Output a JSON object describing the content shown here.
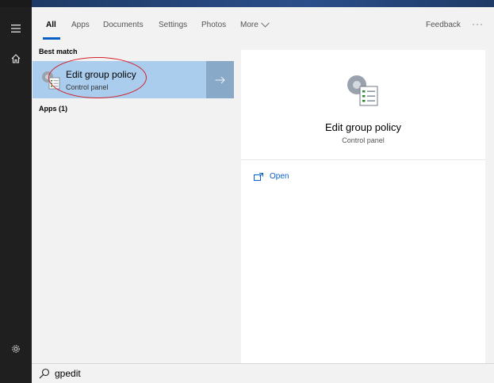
{
  "tabs": [
    {
      "label": "All",
      "active": true
    },
    {
      "label": "Apps"
    },
    {
      "label": "Documents"
    },
    {
      "label": "Settings"
    },
    {
      "label": "Photos"
    },
    {
      "label": "More"
    }
  ],
  "feedback_label": "Feedback",
  "more_options_label": "···",
  "sections": {
    "best_match": "Best match",
    "apps": "Apps (1)"
  },
  "best_match_result": {
    "title": "Edit group policy",
    "subtitle": "Control panel",
    "icon": "group-policy-icon"
  },
  "preview": {
    "title": "Edit group policy",
    "subtitle": "Control panel",
    "actions": [
      {
        "label": "Open",
        "icon": "open-icon"
      }
    ]
  },
  "search": {
    "query": "gpedit"
  },
  "colors": {
    "accent": "#0a5fc7",
    "selected_bg": "#aacdee",
    "highlight_ring": "#d3202a",
    "rail_bg": "#1f1f1f"
  }
}
